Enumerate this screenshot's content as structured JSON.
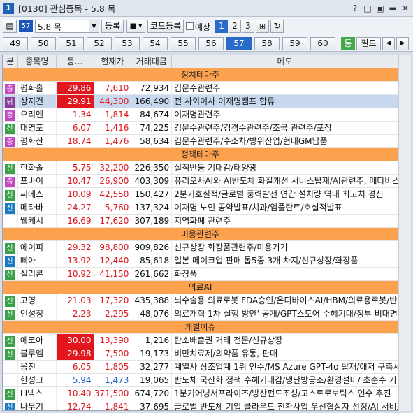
{
  "window": {
    "icon_label": "1",
    "title": "[0130] 관심종목 - 5.8 목",
    "controls": [
      "?",
      "□",
      "▣",
      "▬",
      "✕"
    ]
  },
  "toolbar": {
    "group_badge": "57",
    "group_select": "5.8 목",
    "register_label": "등록",
    "code_register_label": "코드등록",
    "forecast_label": "예상",
    "pages": [
      "1",
      "2",
      "3"
    ],
    "active_page": "1"
  },
  "tabs": [
    "49",
    "50",
    "51",
    "52",
    "53",
    "54",
    "55",
    "56",
    "57",
    "58",
    "59",
    "60"
  ],
  "active_tab": "57",
  "right_buttons": {
    "tong": "통",
    "field": "필드",
    "prev": "◀",
    "next": "▶"
  },
  "columns": [
    "분",
    "종목명",
    "등...",
    "현재가",
    "거래대금",
    "메모"
  ],
  "rows": [
    {
      "type": "group",
      "label": "정치테마주"
    },
    {
      "type": "stock",
      "badge": "증",
      "badge_color": "#c048c0",
      "name": "평화홀",
      "change": "29.86",
      "price": "7,610",
      "volume": "72,934",
      "memo": "김문수관련주",
      "color": "red",
      "limit": true
    },
    {
      "type": "stock",
      "badge": "위",
      "badge_color": "#8a3a9a",
      "name": "상지건",
      "change": "29.91",
      "price": "44,300",
      "volume": "166,490",
      "memo": "전 사외이사 이재명캠프 합류",
      "color": "red",
      "limit": true,
      "selected": true
    },
    {
      "type": "stock",
      "badge": "증",
      "badge_color": "#c048c0",
      "name": "오리엔",
      "change": "1.34",
      "price": "1,814",
      "volume": "84,674",
      "memo": "이재명관련주",
      "color": "red"
    },
    {
      "type": "stock",
      "badge": "신",
      "badge_color": "#3aa04a",
      "name": "대영포",
      "change": "6.07",
      "price": "1,416",
      "volume": "74,225",
      "memo": "김문수관련주/김경수관련주/조국 관련주/포장",
      "color": "red"
    },
    {
      "type": "stock",
      "badge": "증",
      "badge_color": "#c048c0",
      "name": "평화산",
      "change": "18.74",
      "price": "1,476",
      "volume": "58,634",
      "memo": "김문수관련주/수소차/방위산업/현대GM납품",
      "color": "red"
    },
    {
      "type": "group",
      "label": "정책테마주"
    },
    {
      "type": "stock",
      "badge": "신",
      "badge_color": "#3aa04a",
      "name": "한화솔",
      "change": "5.75",
      "price": "32,200",
      "volume": "226,350",
      "memo": "실적반등 기대감/태양광",
      "color": "red"
    },
    {
      "type": "stock",
      "badge": "증",
      "badge_color": "#c048c0",
      "name": "포바이",
      "change": "10.47",
      "price": "26,900",
      "volume": "403,309",
      "memo": "퓨리오사AI와 AI반도체 화질개선 서비스탑재/AI관련주, 메타버스",
      "color": "red"
    },
    {
      "type": "stock",
      "badge": "신",
      "badge_color": "#3aa04a",
      "name": "씨에스",
      "change": "10.09",
      "price": "42,550",
      "volume": "150,427",
      "memo": "2분기호실적/글로벌 풍력발전 연간 설치량 역대 최고치 경신",
      "color": "red"
    },
    {
      "type": "stock",
      "badge": "신",
      "badge_color": "#1a7bc2",
      "name": "메타바",
      "change": "24.27",
      "price": "5,760",
      "volume": "137,324",
      "memo": "이재명 노인 공약발표/치과/임플란트/호실적발표",
      "color": "red"
    },
    {
      "type": "stock",
      "badge": "",
      "badge_color": "",
      "name": "웹케시",
      "change": "16.69",
      "price": "17,620",
      "volume": "307,189",
      "memo": "지역화폐 관련주",
      "color": "red"
    },
    {
      "type": "group",
      "label": "미용관련주"
    },
    {
      "type": "stock",
      "badge": "신",
      "badge_color": "#3aa04a",
      "name": "에이피",
      "change": "29.32",
      "price": "98,800",
      "volume": "909,826",
      "memo": "신규상장 화장품관련주/미용기기",
      "color": "red"
    },
    {
      "type": "stock",
      "badge": "신",
      "badge_color": "#1a7bc2",
      "name": "삐아",
      "change": "13.92",
      "price": "12,440",
      "volume": "85,618",
      "memo": "일본 메이크업 판매 톱5중 3개 차지/신규상장/화장품",
      "color": "red"
    },
    {
      "type": "stock",
      "badge": "신",
      "badge_color": "#3aa04a",
      "name": "실리콘",
      "change": "10.92",
      "price": "41,150",
      "volume": "261,662",
      "memo": "화장품",
      "color": "red"
    },
    {
      "type": "group",
      "label": "의료AI"
    },
    {
      "type": "stock",
      "badge": "신",
      "badge_color": "#3aa04a",
      "name": "고영",
      "change": "21.03",
      "price": "17,320",
      "volume": "435,388",
      "memo": "뇌수술용 의료로봇 FDA승인/온디바이스AI/HBM/의료용로봇/반도체",
      "color": "red"
    },
    {
      "type": "stock",
      "badge": "신",
      "badge_color": "#3aa04a",
      "name": "인성정",
      "change": "2.23",
      "price": "2,295",
      "volume": "48,076",
      "memo": "의료개혁 1차 실행 방안' 공개/GPT스토어 수혜기대/정부 비대면",
      "color": "red"
    },
    {
      "type": "group",
      "label": "개별이슈"
    },
    {
      "type": "stock",
      "badge": "신",
      "badge_color": "#3aa04a",
      "name": "에코아",
      "change": "30.00",
      "price": "13,390",
      "volume": "1,216",
      "memo": "탄소배출권 거래 전문/신규상장",
      "color": "red",
      "limit": true
    },
    {
      "type": "stock",
      "badge": "신",
      "badge_color": "#3aa04a",
      "name": "블루엠",
      "change": "29.98",
      "price": "7,500",
      "volume": "19,173",
      "memo": "비만치료제/의약품 유통, 판매",
      "color": "red",
      "limit": true
    },
    {
      "type": "stock",
      "badge": "",
      "badge_color": "",
      "name": "웅진",
      "change": "6.05",
      "price": "1,805",
      "volume": "32,277",
      "memo": "계열사 상조업계 1위 인수/MS Azure GPT-4o 탑재/애저 구축서비스",
      "color": "red"
    },
    {
      "type": "stock",
      "badge": "",
      "badge_color": "",
      "name": "한성크",
      "change": "5.94",
      "price": "1,473",
      "volume": "19,065",
      "memo": "반도체 국산화 정책 수혜기대감/냉난방공조/환경설비/ 초순수 기",
      "color": "blue"
    },
    {
      "type": "stock",
      "badge": "신",
      "badge_color": "#3aa04a",
      "name": "LI넥스",
      "change": "10.40",
      "price": "371,500",
      "volume": "674,720",
      "memo": "1분기어닝서프라이즈/방산펀드조성/고스트로보틱스 인수 추진",
      "color": "red"
    },
    {
      "type": "stock",
      "badge": "신",
      "badge_color": "#1a7bc2",
      "name": "나무기",
      "change": "12.74",
      "price": "1,841",
      "volume": "37,695",
      "memo": "글로벌 반도체 기업 클라우드 전환사업 우선협상자 선정/AI 서비스",
      "color": "red"
    },
    {
      "type": "stock",
      "badge": "신",
      "badge_color": "#3aa04a",
      "name": "한화비",
      "change": "4.15",
      "price": "62,700",
      "volume": "207,244",
      "memo": "반도체/신규상장/한화에어로스페이스 인적분할",
      "color": "red"
    }
  ]
}
